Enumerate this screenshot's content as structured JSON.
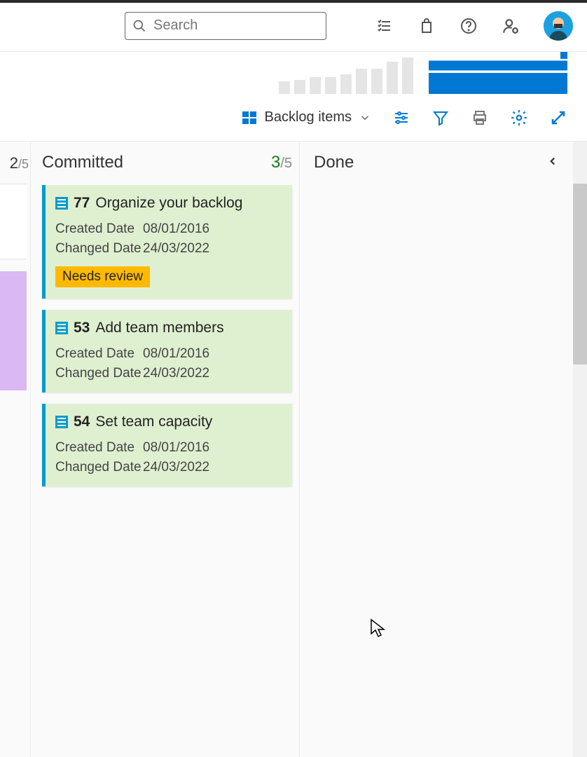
{
  "search": {
    "placeholder": "Search"
  },
  "toolbar": {
    "backlog_label": "Backlog items"
  },
  "columns": {
    "prev": {
      "count_fragment": "2",
      "limit": "/5"
    },
    "committed": {
      "title": "Committed",
      "count": "3",
      "limit": "/5"
    },
    "done": {
      "title": "Done"
    }
  },
  "fields": {
    "created_label": "Created Date",
    "changed_label": "Changed Date"
  },
  "cards": [
    {
      "id": "77",
      "title": "Organize your backlog",
      "created": "08/01/2016",
      "changed": "24/03/2022",
      "tag": "Needs review"
    },
    {
      "id": "53",
      "title": "Add team members",
      "created": "08/01/2016",
      "changed": "24/03/2022"
    },
    {
      "id": "54",
      "title": "Set team capacity",
      "created": "08/01/2016",
      "changed": "24/03/2022"
    }
  ],
  "chart_data": {
    "type": "bar",
    "note": "decorative sparkline bars, unlabeled",
    "values": [
      18,
      20,
      24,
      24,
      28,
      36,
      36,
      46,
      52
    ]
  }
}
